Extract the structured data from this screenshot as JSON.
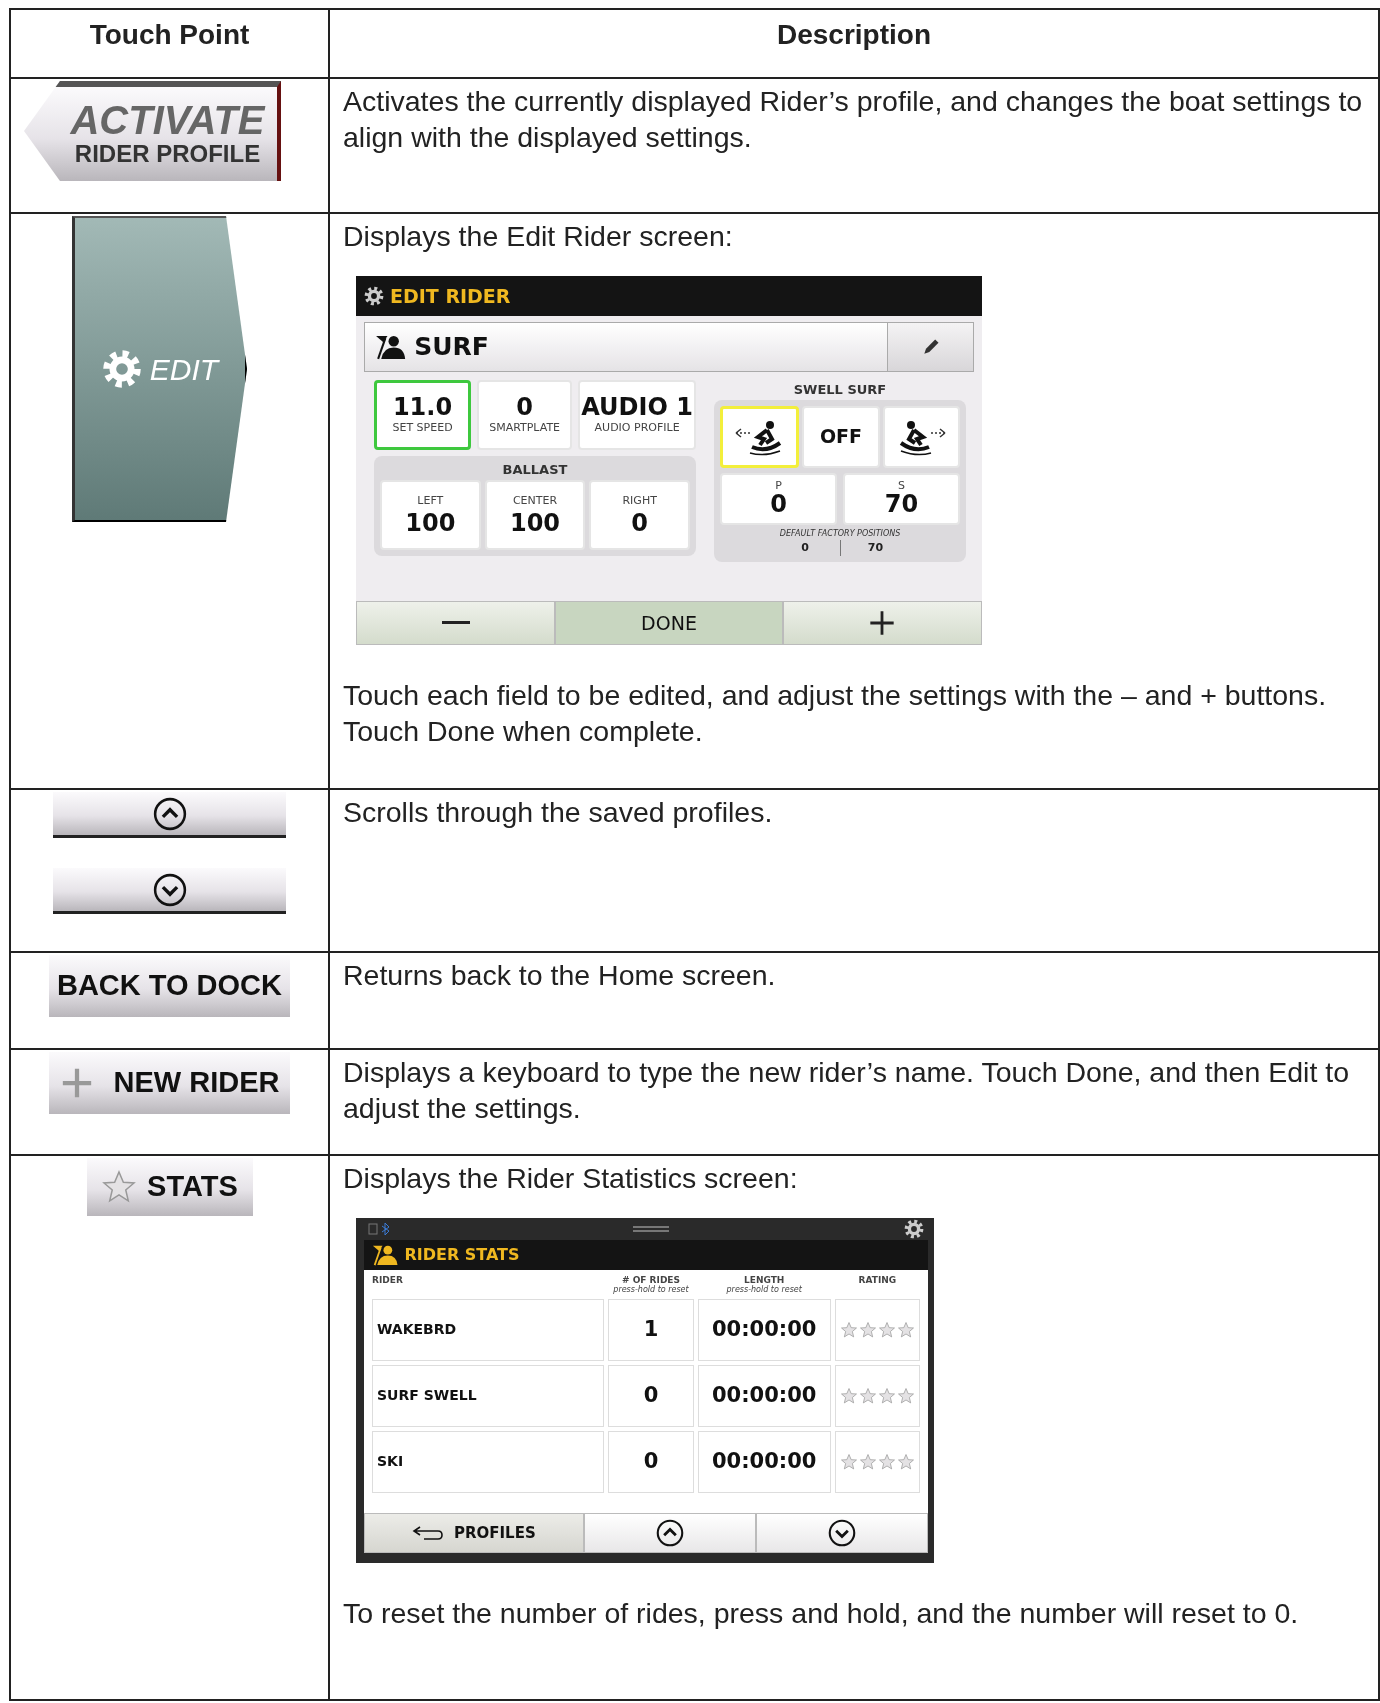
{
  "table": {
    "columns": [
      "Touch Point",
      "Description"
    ],
    "rows": [
      {
        "touch_point": {
          "kind": "activate",
          "line_1": "ACTIVATE",
          "line_2": "RIDER PROFILE"
        },
        "description": [
          "Activates the currently displayed Rider’s profile, and changes the boat settings to align with the displayed settings."
        ]
      },
      {
        "touch_point": {
          "kind": "edit",
          "label": "EDIT"
        },
        "description": [
          "Displays the Edit Rider screen:",
          "Touch each field to be edited, and adjust the settings with the – and + buttons.  Touch Done when complete."
        ],
        "screen": {
          "kind": "edit_rider",
          "title": "EDIT RIDER",
          "rider_name": "SURF",
          "tiles": [
            {
              "value": "11.0",
              "label": "SET SPEED",
              "selected": true
            },
            {
              "value": "0",
              "label": "SMARTPLATE",
              "selected": false
            },
            {
              "value": "AUDIO 1",
              "label": "AUDIO PROFILE",
              "selected": false
            }
          ],
          "ballast": {
            "title": "BALLAST",
            "tanks": [
              {
                "label": "LEFT",
                "value": "100"
              },
              {
                "label": "CENTER",
                "value": "100"
              },
              {
                "label": "RIGHT",
                "value": "0"
              }
            ]
          },
          "swell_surf": {
            "title": "SWELL SURF",
            "sides": [
              {
                "kind": "left",
                "selected": true
              },
              {
                "kind": "off",
                "label": "OFF",
                "selected": false
              },
              {
                "kind": "right",
                "selected": false
              }
            ],
            "positions": [
              {
                "label": "P",
                "value": "0"
              },
              {
                "label": "S",
                "value": "70"
              }
            ],
            "default_title": "DEFAULT FACTORY POSITIONS",
            "defaults": [
              "0",
              "70"
            ]
          },
          "buttons": [
            {
              "kind": "minus"
            },
            {
              "kind": "done",
              "label": "DONE"
            },
            {
              "kind": "plus"
            }
          ]
        }
      },
      {
        "touch_point": {
          "kind": "scroll",
          "buttons": [
            {
              "kind": "up"
            },
            {
              "kind": "down"
            }
          ]
        },
        "description": [
          "Scrolls through the saved profiles."
        ]
      },
      {
        "touch_point": {
          "kind": "text",
          "label": "BACK TO DOCK"
        },
        "description": [
          "Returns back to the Home screen."
        ]
      },
      {
        "touch_point": {
          "kind": "plus",
          "label": "NEW RIDER"
        },
        "description": [
          "Displays a keyboard to type the new rider’s name.  Touch Done, and then Edit to adjust the settings."
        ]
      },
      {
        "touch_point": {
          "kind": "star",
          "label": "STATS"
        },
        "description": [
          "Displays the Rider Statistics screen:",
          "To reset the number of rides, press and hold, and the number will reset to 0."
        ],
        "screen": {
          "kind": "rider_stats",
          "title": "RIDER STATS",
          "columns": [
            {
              "label": "RIDER"
            },
            {
              "label": "# OF RIDES",
              "hint": "press-hold to reset"
            },
            {
              "label": "LENGTH",
              "hint": "press-hold to reset"
            },
            {
              "label": "RATING"
            }
          ],
          "rows": [
            {
              "rider": "WAKEBRD",
              "rides": "1",
              "length": "00:00:00",
              "stars": 0
            },
            {
              "rider": "SURF SWELL",
              "rides": "0",
              "length": "00:00:00",
              "stars": 0
            },
            {
              "rider": "SKI",
              "rides": "0",
              "length": "00:00:00",
              "stars": 0
            }
          ],
          "footer": [
            {
              "kind": "back",
              "label": "PROFILES"
            },
            {
              "kind": "up"
            },
            {
              "kind": "down"
            }
          ]
        }
      }
    ]
  }
}
